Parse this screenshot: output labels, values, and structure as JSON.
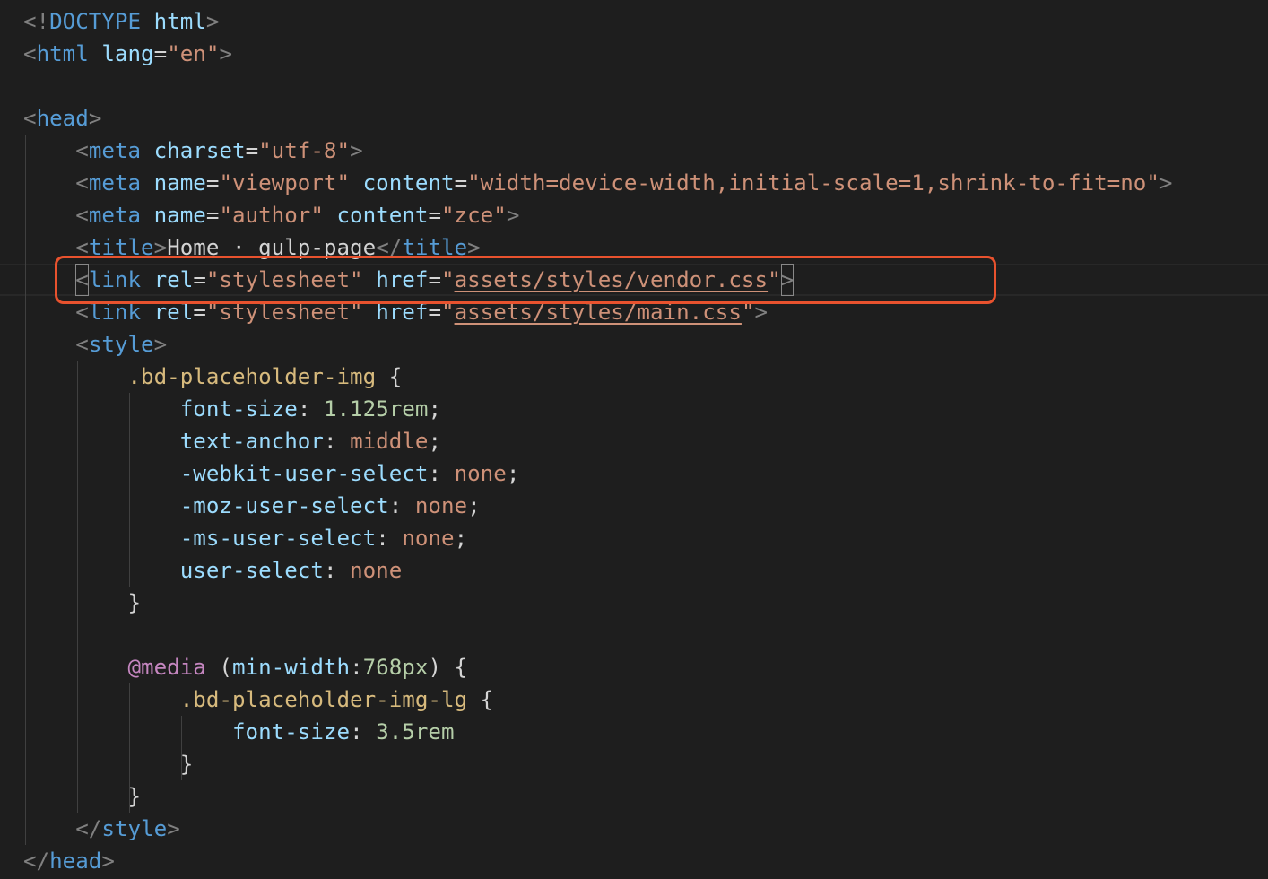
{
  "editor": {
    "lines": [
      {
        "tokens": [
          {
            "text": "<!",
            "kind": "punct"
          },
          {
            "text": "DOCTYPE",
            "kind": "tag"
          },
          {
            "text": " ",
            "kind": "text"
          },
          {
            "text": "html",
            "kind": "attr"
          },
          {
            "text": ">",
            "kind": "punct"
          }
        ]
      },
      {
        "tokens": [
          {
            "text": "<",
            "kind": "punct"
          },
          {
            "text": "html",
            "kind": "tag"
          },
          {
            "text": " ",
            "kind": "text"
          },
          {
            "text": "lang",
            "kind": "attr"
          },
          {
            "text": "=",
            "kind": "text"
          },
          {
            "text": "\"en\"",
            "kind": "str"
          },
          {
            "text": ">",
            "kind": "punct"
          }
        ]
      },
      {
        "tokens": []
      },
      {
        "tokens": [
          {
            "text": "<",
            "kind": "punct"
          },
          {
            "text": "head",
            "kind": "tag"
          },
          {
            "text": ">",
            "kind": "punct"
          }
        ]
      },
      {
        "tokens": [
          {
            "text": "    ",
            "kind": "text"
          },
          {
            "text": "<",
            "kind": "punct"
          },
          {
            "text": "meta",
            "kind": "tag"
          },
          {
            "text": " ",
            "kind": "text"
          },
          {
            "text": "charset",
            "kind": "attr"
          },
          {
            "text": "=",
            "kind": "text"
          },
          {
            "text": "\"utf-8\"",
            "kind": "str"
          },
          {
            "text": ">",
            "kind": "punct"
          }
        ]
      },
      {
        "tokens": [
          {
            "text": "    ",
            "kind": "text"
          },
          {
            "text": "<",
            "kind": "punct"
          },
          {
            "text": "meta",
            "kind": "tag"
          },
          {
            "text": " ",
            "kind": "text"
          },
          {
            "text": "name",
            "kind": "attr"
          },
          {
            "text": "=",
            "kind": "text"
          },
          {
            "text": "\"viewport\"",
            "kind": "str"
          },
          {
            "text": " ",
            "kind": "text"
          },
          {
            "text": "content",
            "kind": "attr"
          },
          {
            "text": "=",
            "kind": "text"
          },
          {
            "text": "\"width=device-width,initial-scale=1,shrink-to-fit=no\"",
            "kind": "str"
          },
          {
            "text": ">",
            "kind": "punct"
          }
        ]
      },
      {
        "tokens": [
          {
            "text": "    ",
            "kind": "text"
          },
          {
            "text": "<",
            "kind": "punct"
          },
          {
            "text": "meta",
            "kind": "tag"
          },
          {
            "text": " ",
            "kind": "text"
          },
          {
            "text": "name",
            "kind": "attr"
          },
          {
            "text": "=",
            "kind": "text"
          },
          {
            "text": "\"author\"",
            "kind": "str"
          },
          {
            "text": " ",
            "kind": "text"
          },
          {
            "text": "content",
            "kind": "attr"
          },
          {
            "text": "=",
            "kind": "text"
          },
          {
            "text": "\"zce\"",
            "kind": "str"
          },
          {
            "text": ">",
            "kind": "punct"
          }
        ]
      },
      {
        "tokens": [
          {
            "text": "    ",
            "kind": "text"
          },
          {
            "text": "<",
            "kind": "punct"
          },
          {
            "text": "title",
            "kind": "tag"
          },
          {
            "text": ">",
            "kind": "punct"
          },
          {
            "text": "Home · gulp-page",
            "kind": "text"
          },
          {
            "text": "</",
            "kind": "punct"
          },
          {
            "text": "title",
            "kind": "tag"
          },
          {
            "text": ">",
            "kind": "punct"
          }
        ]
      },
      {
        "tokens": [
          {
            "text": "    ",
            "kind": "text"
          },
          {
            "text": "<",
            "kind": "punct",
            "bracket": true
          },
          {
            "text": "link",
            "kind": "tag"
          },
          {
            "text": " ",
            "kind": "text"
          },
          {
            "text": "rel",
            "kind": "attr"
          },
          {
            "text": "=",
            "kind": "text"
          },
          {
            "text": "\"stylesheet\"",
            "kind": "str"
          },
          {
            "text": " ",
            "kind": "text"
          },
          {
            "text": "href",
            "kind": "attr"
          },
          {
            "text": "=",
            "kind": "text"
          },
          {
            "text": "\"",
            "kind": "str"
          },
          {
            "text": "assets/styles/vendor.css",
            "kind": "str",
            "link": true
          },
          {
            "text": "\"",
            "kind": "str"
          },
          {
            "text": ">",
            "kind": "punct",
            "bracket": true
          }
        ]
      },
      {
        "tokens": [
          {
            "text": "    ",
            "kind": "text"
          },
          {
            "text": "<",
            "kind": "punct"
          },
          {
            "text": "link",
            "kind": "tag"
          },
          {
            "text": " ",
            "kind": "text"
          },
          {
            "text": "rel",
            "kind": "attr"
          },
          {
            "text": "=",
            "kind": "text"
          },
          {
            "text": "\"stylesheet\"",
            "kind": "str"
          },
          {
            "text": " ",
            "kind": "text"
          },
          {
            "text": "href",
            "kind": "attr"
          },
          {
            "text": "=",
            "kind": "text"
          },
          {
            "text": "\"",
            "kind": "str"
          },
          {
            "text": "assets/styles/main.css",
            "kind": "str",
            "link": true
          },
          {
            "text": "\"",
            "kind": "str"
          },
          {
            "text": ">",
            "kind": "punct"
          }
        ]
      },
      {
        "tokens": [
          {
            "text": "    ",
            "kind": "text"
          },
          {
            "text": "<",
            "kind": "punct"
          },
          {
            "text": "style",
            "kind": "tag"
          },
          {
            "text": ">",
            "kind": "punct"
          }
        ]
      },
      {
        "tokens": [
          {
            "text": "        ",
            "kind": "text"
          },
          {
            "text": ".bd-placeholder-img",
            "kind": "sel"
          },
          {
            "text": " {",
            "kind": "brace"
          }
        ]
      },
      {
        "tokens": [
          {
            "text": "            ",
            "kind": "text"
          },
          {
            "text": "font-size",
            "kind": "prop"
          },
          {
            "text": ": ",
            "kind": "brace"
          },
          {
            "text": "1.125rem",
            "kind": "num"
          },
          {
            "text": ";",
            "kind": "brace"
          }
        ]
      },
      {
        "tokens": [
          {
            "text": "            ",
            "kind": "text"
          },
          {
            "text": "text-anchor",
            "kind": "prop"
          },
          {
            "text": ": ",
            "kind": "brace"
          },
          {
            "text": "middle",
            "kind": "val"
          },
          {
            "text": ";",
            "kind": "brace"
          }
        ]
      },
      {
        "tokens": [
          {
            "text": "            ",
            "kind": "text"
          },
          {
            "text": "-webkit-user-select",
            "kind": "prop"
          },
          {
            "text": ": ",
            "kind": "brace"
          },
          {
            "text": "none",
            "kind": "val"
          },
          {
            "text": ";",
            "kind": "brace"
          }
        ]
      },
      {
        "tokens": [
          {
            "text": "            ",
            "kind": "text"
          },
          {
            "text": "-moz-user-select",
            "kind": "prop"
          },
          {
            "text": ": ",
            "kind": "brace"
          },
          {
            "text": "none",
            "kind": "val"
          },
          {
            "text": ";",
            "kind": "brace"
          }
        ]
      },
      {
        "tokens": [
          {
            "text": "            ",
            "kind": "text"
          },
          {
            "text": "-ms-user-select",
            "kind": "prop"
          },
          {
            "text": ": ",
            "kind": "brace"
          },
          {
            "text": "none",
            "kind": "val"
          },
          {
            "text": ";",
            "kind": "brace"
          }
        ]
      },
      {
        "tokens": [
          {
            "text": "            ",
            "kind": "text"
          },
          {
            "text": "user-select",
            "kind": "prop"
          },
          {
            "text": ": ",
            "kind": "brace"
          },
          {
            "text": "none",
            "kind": "val"
          }
        ]
      },
      {
        "tokens": [
          {
            "text": "        ",
            "kind": "text"
          },
          {
            "text": "}",
            "kind": "brace"
          }
        ]
      },
      {
        "tokens": []
      },
      {
        "tokens": [
          {
            "text": "        ",
            "kind": "text"
          },
          {
            "text": "@media",
            "kind": "at"
          },
          {
            "text": " (",
            "kind": "brace"
          },
          {
            "text": "min-width",
            "kind": "prop"
          },
          {
            "text": ":",
            "kind": "brace"
          },
          {
            "text": "768px",
            "kind": "num"
          },
          {
            "text": ") {",
            "kind": "brace"
          }
        ]
      },
      {
        "tokens": [
          {
            "text": "            ",
            "kind": "text"
          },
          {
            "text": ".bd-placeholder-img-lg",
            "kind": "sel"
          },
          {
            "text": " {",
            "kind": "brace"
          }
        ]
      },
      {
        "tokens": [
          {
            "text": "                ",
            "kind": "text"
          },
          {
            "text": "font-size",
            "kind": "prop"
          },
          {
            "text": ": ",
            "kind": "brace"
          },
          {
            "text": "3.5rem",
            "kind": "num"
          }
        ]
      },
      {
        "tokens": [
          {
            "text": "            ",
            "kind": "text"
          },
          {
            "text": "}",
            "kind": "brace"
          }
        ]
      },
      {
        "tokens": [
          {
            "text": "        ",
            "kind": "text"
          },
          {
            "text": "}",
            "kind": "brace"
          }
        ]
      },
      {
        "tokens": [
          {
            "text": "    ",
            "kind": "text"
          },
          {
            "text": "</",
            "kind": "punct"
          },
          {
            "text": "style",
            "kind": "tag"
          },
          {
            "text": ">",
            "kind": "punct"
          }
        ]
      },
      {
        "tokens": [
          {
            "text": "</",
            "kind": "punct"
          },
          {
            "text": "head",
            "kind": "tag"
          },
          {
            "text": ">",
            "kind": "punct"
          }
        ]
      }
    ]
  },
  "highlight": {
    "line_number": 9,
    "color": "#e8522e"
  },
  "theme": {
    "background": "#1e1e1e"
  }
}
